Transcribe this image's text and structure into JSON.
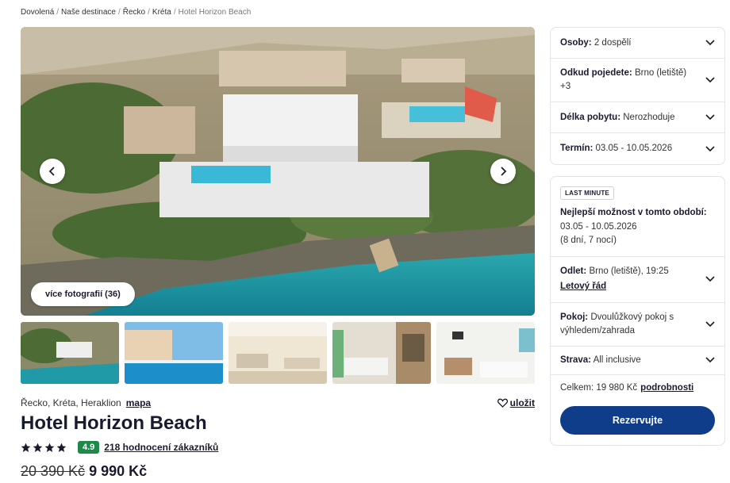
{
  "breadcrumb": [
    {
      "label": "Dovolená"
    },
    {
      "label": "Naše destinace"
    },
    {
      "label": "Řecko"
    },
    {
      "label": "Kréta"
    },
    {
      "label": "Hotel Horizon Beach"
    }
  ],
  "gallery": {
    "more_photos": "více fotografií (36)",
    "prev_icon": "chevron-left-icon",
    "next_icon": "chevron-right-icon"
  },
  "location": {
    "text": "Řecko, Kréta, Heraklion",
    "map_link": "mapa",
    "save_label": "uložit",
    "save_icon": "heart-icon"
  },
  "hotel": {
    "name": "Hotel Horizon Beach",
    "stars": 4,
    "score": "4.9",
    "reviews": "218 hodnocení zákazníků",
    "old_price": "20 390 Kč",
    "new_price": "9 990 Kč"
  },
  "filters": [
    {
      "label": "Osoby:",
      "value": "2 dospělí"
    },
    {
      "label": "Odkud pojedete:",
      "value": "Brno (letiště) +3"
    },
    {
      "label": "Délka pobytu:",
      "value": "Nerozhoduje"
    },
    {
      "label": "Termín:",
      "value": "03.05 - 10.05.2026"
    }
  ],
  "offer": {
    "badge": "LAST MINUTE",
    "best_label": "Nejlepší možnost v tomto období:",
    "best_dates": "03.05 - 10.05.2026",
    "best_nights": "(8 dní, 7 nocí)",
    "departure_label": "Odlet:",
    "departure_value": "Brno (letiště), 19:25",
    "flight_link": "Letový řád",
    "room_label": "Pokoj:",
    "room_value": "Dvoulůžkový pokoj s výhledem/zahrada",
    "board_label": "Strava:",
    "board_value": "All inclusive",
    "total_label": "Celkem: 19 980 Kč",
    "details_link": "podrobnosti",
    "book_button": "Rezervujte"
  },
  "colors": {
    "primary": "#0f3d8a",
    "score_badge": "#1d8a4a",
    "text": "#1a1a2e",
    "sea": "#1f9aa6"
  }
}
